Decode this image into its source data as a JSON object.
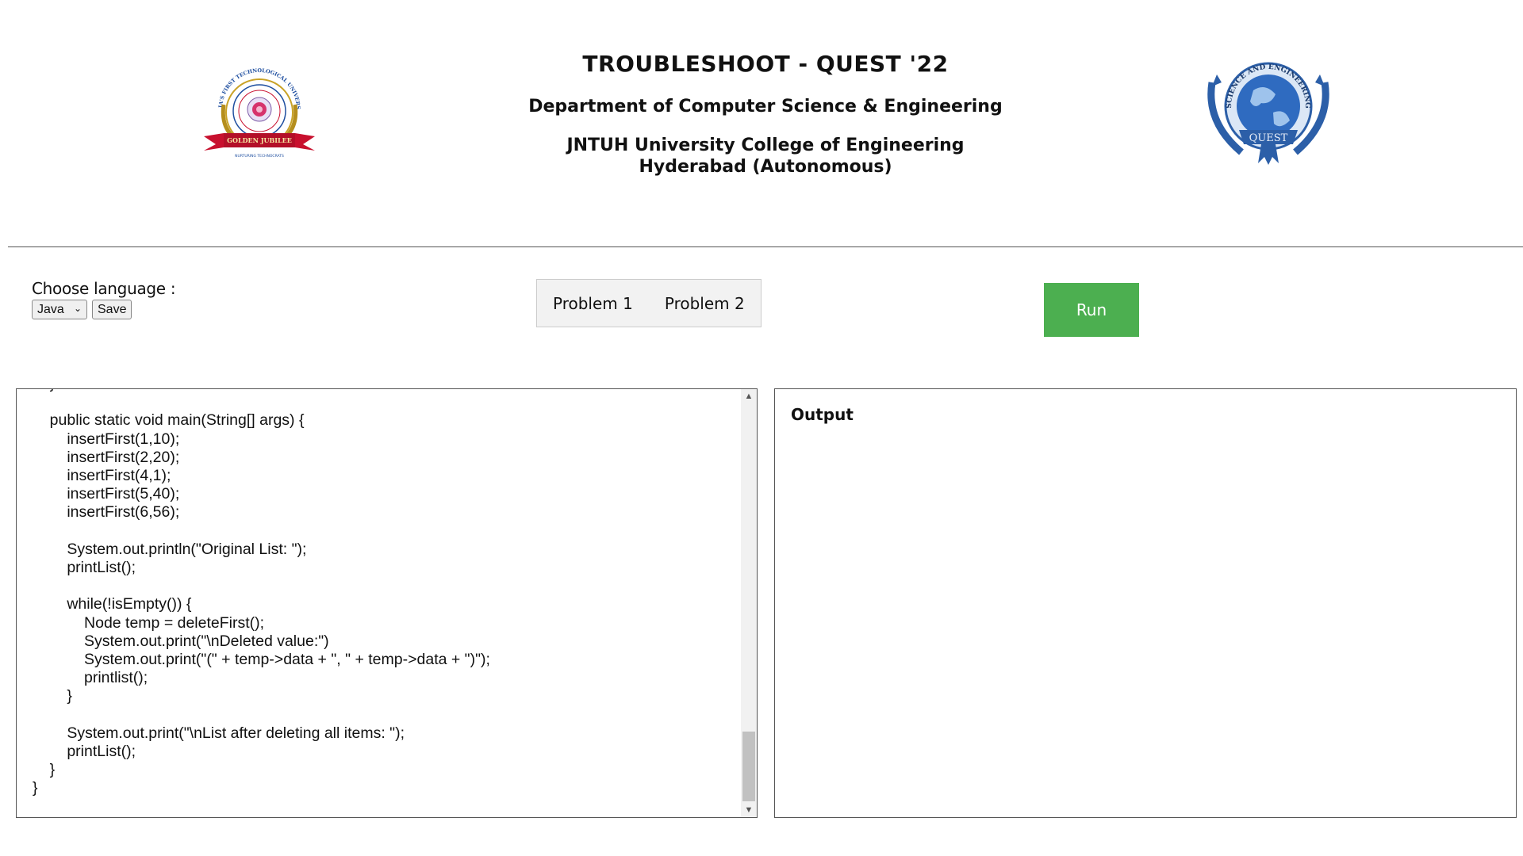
{
  "header": {
    "title": "TROUBLESHOOT - QUEST '22",
    "department": "Department of Computer Science & Engineering",
    "college_line1": "JNTUH University College of Engineering",
    "college_line2": "Hyderabad (Autonomous)",
    "left_logo": {
      "icon": "jntuh-golden-jubilee-logo",
      "text_top": "INDIA'S FIRST TECHNOLOGICAL UNIVERSITY",
      "text_ribbon": "GOLDEN JUBILEE",
      "text_bottom": "NURTURING TECHNOCRATS",
      "colors": {
        "gold": "#c9a227",
        "red": "#c8102e",
        "blue": "#1f4fa0"
      }
    },
    "right_logo": {
      "icon": "quest-globe-emblem",
      "text_arc": "SCIENCE AND ENGINEERING",
      "text_banner": "QUEST",
      "colors": {
        "blue": "#2c5fa8",
        "light": "#9ec3ec"
      }
    }
  },
  "controls": {
    "language_label": "Choose language :",
    "language_selected": "Java",
    "save_label": "Save",
    "problems": [
      "Problem 1",
      "Problem 2"
    ],
    "run_label": "Run",
    "run_color": "#4caf50"
  },
  "editor": {
    "code": "    }\n\n    public static void main(String[] args) {\n        insertFirst(1,10);\n        insertFirst(2,20);\n        insertFirst(4,1);\n        insertFirst(5,40);\n        insertFirst(6,56);\n\n        System.out.println(\"Original List: \");\n        printList();\n\n        while(!isEmpty()) {\n            Node temp = deleteFirst();\n            System.out.print(\"\\nDeleted value:\")\n            System.out.print(\"(\" + temp->data + \", \" + temp->data + \")\");\n            printlist();\n        }\n\n        System.out.print(\"\\nList after deleting all items: \");\n        printList();\n    }\n}"
  },
  "output": {
    "label": "Output",
    "content": ""
  }
}
